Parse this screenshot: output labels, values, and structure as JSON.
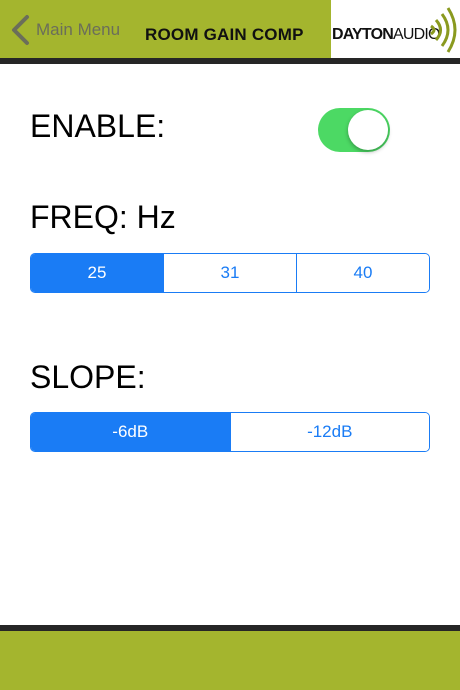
{
  "header": {
    "back_label": "Main Menu",
    "title": "ROOM GAIN COMP",
    "logo": {
      "part1": "DAYTON",
      "part2": "AUDIO"
    }
  },
  "enable": {
    "label": "ENABLE:",
    "on": true
  },
  "freq": {
    "label": "FREQ: Hz",
    "options": [
      "25",
      "31",
      "40"
    ],
    "selected": "25"
  },
  "slope": {
    "label": "SLOPE:",
    "options": [
      "-6dB",
      "-12dB"
    ],
    "selected": "-6dB"
  },
  "icons": [
    "chevron-left-icon",
    "dayton-audio-logo"
  ],
  "colors": {
    "header_bg": "#a4b52e",
    "divider": "#262626",
    "accent": "#1a7cf5",
    "toggle_on": "#4cd964",
    "back_text": "#6b6e5a"
  }
}
